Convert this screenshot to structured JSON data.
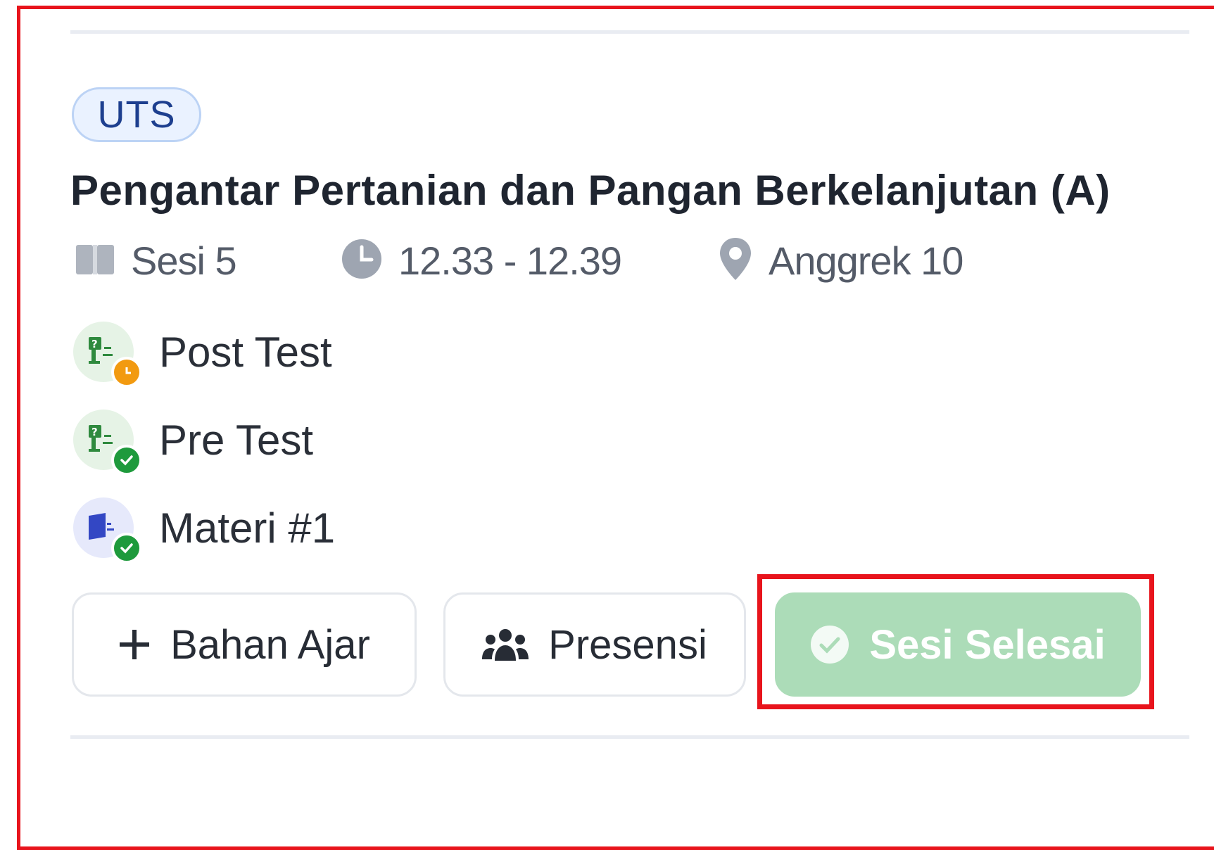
{
  "session": {
    "badge": "UTS",
    "title": "Pengantar Pertanian dan Pangan Berkelanjutan (A)",
    "sesi": "Sesi 5",
    "time": "12.33 - 12.39",
    "location": "Anggrek 10"
  },
  "activities": [
    {
      "label": "Post Test",
      "icon": "quiz-icon",
      "status": "pending",
      "status_color": "#f29a10"
    },
    {
      "label": "Pre Test",
      "icon": "quiz-icon",
      "status": "done",
      "status_color": "#1e9a3c"
    },
    {
      "label": "Materi #1",
      "icon": "material-icon",
      "status": "done",
      "status_color": "#1e9a3c"
    }
  ],
  "actions": {
    "add_material": "Bahan Ajar",
    "attendance": "Presensi",
    "finish_session": "Sesi Selesai"
  },
  "colors": {
    "highlight": "#e8141c",
    "finish_button": "#acdcb8",
    "badge_text": "#1d3f8f"
  }
}
